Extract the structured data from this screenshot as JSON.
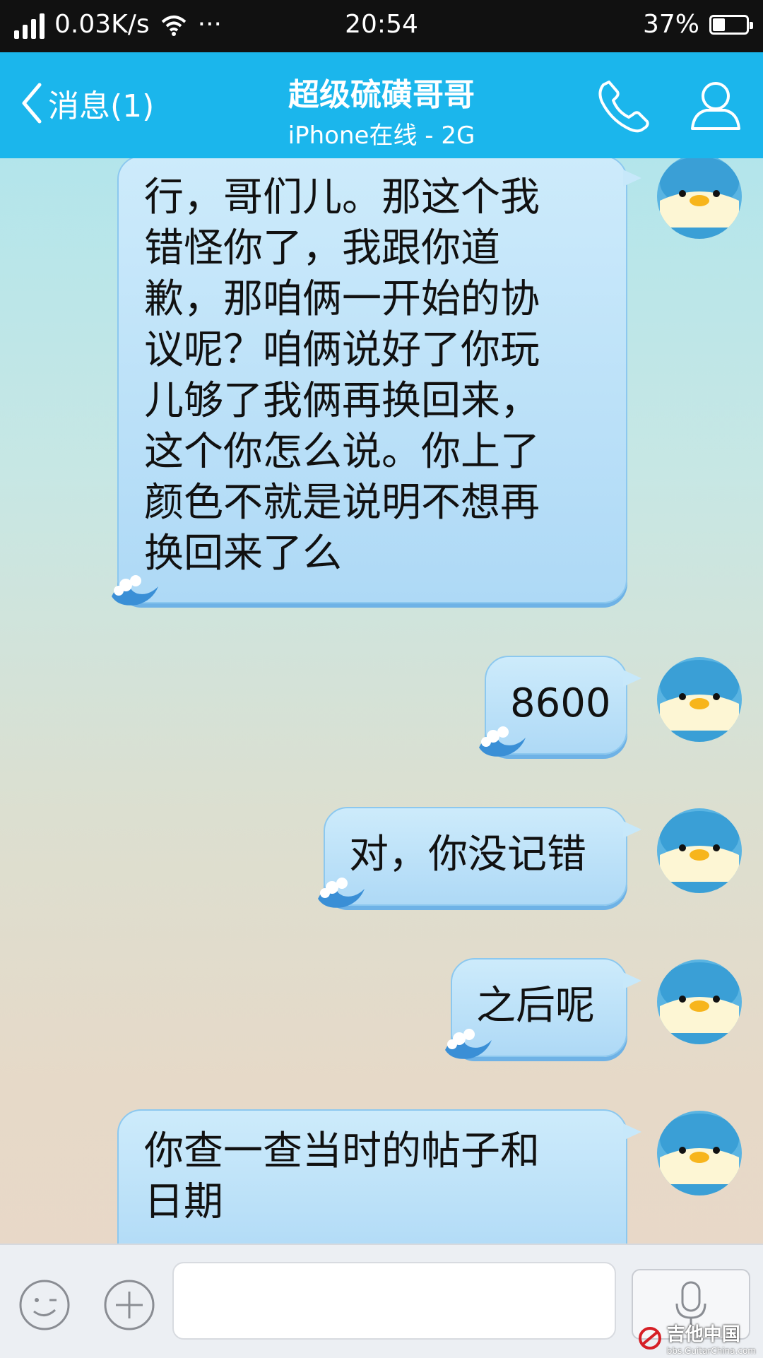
{
  "status_bar": {
    "network_speed": "0.03K/s",
    "more": "···",
    "time": "20:54",
    "battery_percent": "37%",
    "battery_level": 0.37
  },
  "header": {
    "back_label": "消息(1)",
    "contact_name": "超级硫磺哥哥",
    "status": "iPhone在线 - 2G",
    "icons": [
      "phone-icon",
      "profile-icon"
    ]
  },
  "messages": [
    {
      "text": "行，哥们儿。那这个我\n错怪你了，我跟你道\n歉，那咱俩一开始的协\n议呢？咱俩说好了你玩\n儿够了我俩再换回来，\n这个你怎么说。你上了\n颜色不就是说明不想再\n换回来了么"
    },
    {
      "text": "8600"
    },
    {
      "text": "对，你没记错"
    },
    {
      "text": "之后呢"
    },
    {
      "text": "你查一查当时的帖子和\n日期"
    }
  ],
  "input_bar": {
    "icons": [
      "emoji-icon",
      "add-icon",
      "microphone-icon"
    ],
    "text_value": ""
  },
  "watermark": {
    "main": "吉他中国",
    "sub": "bbs.GuitarChina.com"
  },
  "colors": {
    "header_bg": "#1bb6ec",
    "bubble": "#b4ddf7",
    "status_bar_bg": "#111111"
  }
}
